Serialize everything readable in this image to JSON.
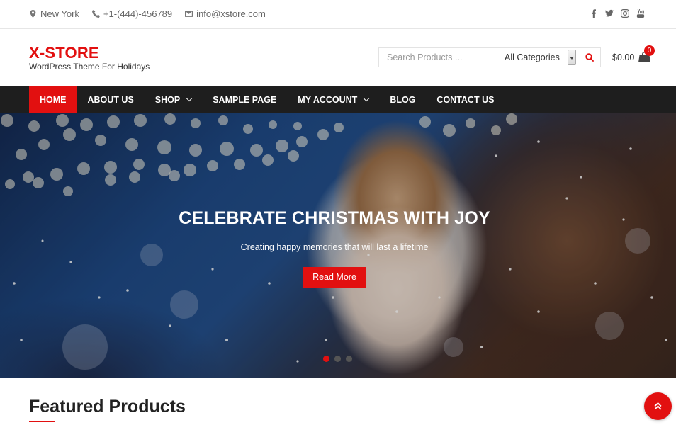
{
  "topbar": {
    "location": "New York",
    "phone": "+1-(444)-456789",
    "email": "info@xstore.com",
    "social": [
      "facebook-icon",
      "twitter-icon",
      "instagram-icon",
      "youtube-icon"
    ]
  },
  "header": {
    "logo_name": "X-STORE",
    "logo_tagline": "WordPress Theme For Holidays",
    "search_placeholder": "Search Products ...",
    "category_selected": "All Categories",
    "cart_total": "$0.00",
    "cart_count": "0"
  },
  "nav": {
    "items": [
      {
        "label": "HOME",
        "active": true
      },
      {
        "label": "ABOUT US"
      },
      {
        "label": "SHOP",
        "dropdown": true
      },
      {
        "label": "SAMPLE PAGE"
      },
      {
        "label": "MY ACCOUNT",
        "dropdown": true
      },
      {
        "label": "BLOG"
      },
      {
        "label": "CONTACT US"
      }
    ]
  },
  "hero": {
    "title": "CELEBRATE CHRISTMAS WITH JOY",
    "subtitle": "Creating happy memories that will last a lifetime",
    "cta": "Read More",
    "slides": 3,
    "active_slide": 1
  },
  "featured": {
    "heading": "Featured Products"
  },
  "colors": {
    "accent": "#e21010",
    "nav_bg": "#1e1e1e"
  }
}
